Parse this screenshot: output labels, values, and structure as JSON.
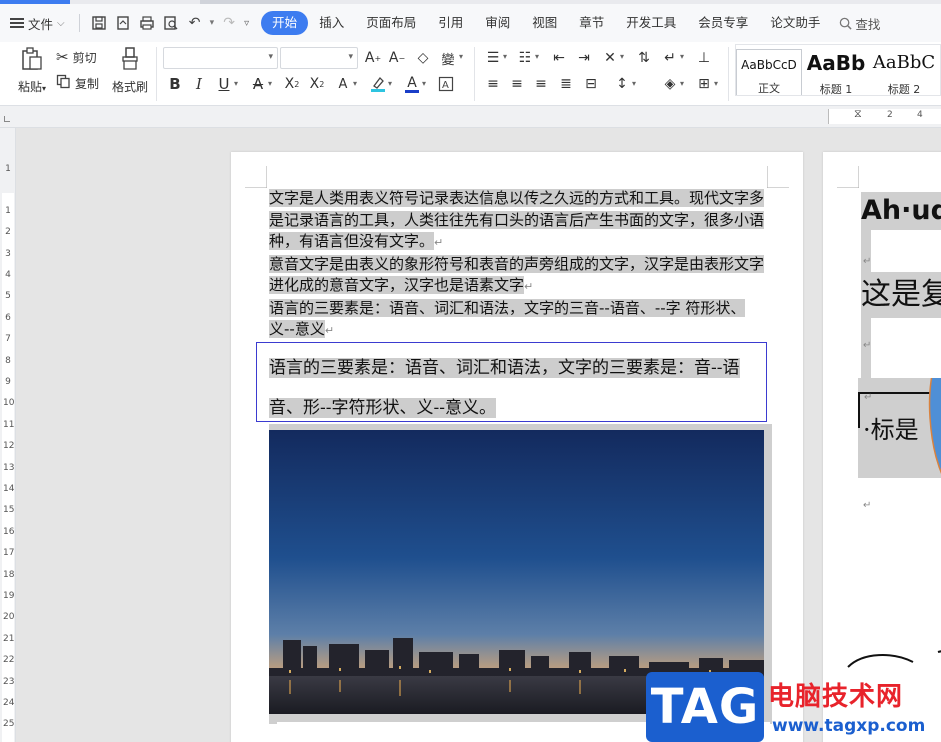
{
  "tabbar": {
    "file_menu": "文件",
    "tabs": [
      {
        "label": "开始",
        "active": true
      },
      {
        "label": "插入"
      },
      {
        "label": "页面布局"
      },
      {
        "label": "引用"
      },
      {
        "label": "审阅"
      },
      {
        "label": "视图"
      },
      {
        "label": "章节"
      },
      {
        "label": "开发工具"
      },
      {
        "label": "会员专享"
      },
      {
        "label": "论文助手"
      }
    ],
    "search_label": "查找"
  },
  "ribbon": {
    "paste": "粘贴",
    "cut": "剪切",
    "copy": "复制",
    "format_painter": "格式刷",
    "font_name": "",
    "font_size": "",
    "styles": [
      {
        "sample": "AaBbCcD",
        "caption": "正文"
      },
      {
        "sample": "AaBb",
        "caption": "标题 1"
      },
      {
        "sample": "AaBbC",
        "caption": "标题 2"
      }
    ]
  },
  "ruler": {
    "h_ticks": [
      "2",
      "4"
    ],
    "v_ticks": [
      "1",
      "1",
      "2",
      "3",
      "4",
      "5",
      "6",
      "7",
      "8",
      "9",
      "10",
      "11",
      "12",
      "13",
      "14",
      "15",
      "16",
      "17",
      "18",
      "19",
      "20",
      "21",
      "22",
      "23",
      "24",
      "25"
    ]
  },
  "document": {
    "page1": {
      "paragraphs": [
        "文字是人类用表义符号记录表达信息以传之久远的方式和工具。现代文字多是记录语言的工具，人类往往先有口头的语言后产生书面的文字，很多小语种，有语言但没有文字。",
        "意音文字是由表义的象形符号和表音的声旁组成的文字，汉字是由表形文字进化成的意音文字，汉字也是语素文字",
        "语言的三要素是：语音、词汇和语法，文字的三音--语音、--字 符形状、义--意义"
      ],
      "frame_text": "语言的三要素是：语音、词汇和语法，文字的三要素是：音--语音、形--字符形状、义--意义。"
    },
    "page2": {
      "heading": "Ah·ud",
      "line2": "这是复",
      "box_label": "·标是"
    }
  },
  "watermark": {
    "tag": "TAG",
    "site_name": "电脑技术网",
    "url": "www.tagxp.com"
  },
  "colors": {
    "accent": "#3d7cf0",
    "selection_gray": "#cdcdcd",
    "frame_border": "#3b3bd0",
    "watermark_blue": "#1b5fcf",
    "watermark_red": "#e8232b"
  }
}
